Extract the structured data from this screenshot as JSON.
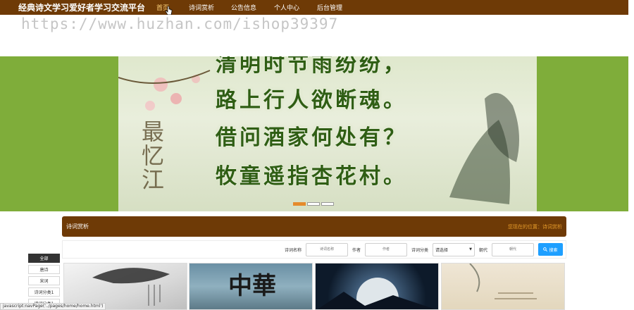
{
  "header": {
    "brand": "经典诗文学习爱好者学习交流平台",
    "nav": [
      "首页",
      "诗词赏析",
      "公告信息",
      "个人中心",
      "后台管理"
    ],
    "active_index": 0
  },
  "watermark": "https://www.huzhan.com/ishop39397",
  "banner": {
    "poem_lines": [
      "清明时节雨纷纷，",
      "路上行人欲断魂。",
      "借问酒家何处有？",
      "牧童遥指杏花村。"
    ],
    "side_text": "最忆江",
    "slide_count": 3,
    "active_slide": 0
  },
  "section": {
    "title": "诗词赏析",
    "breadcrumb_prefix": "您现在的位置：",
    "breadcrumb_current": "诗词赏析"
  },
  "search": {
    "name_label": "诗词名称",
    "name_placeholder": "诗词名称",
    "author_label": "作者",
    "author_placeholder": "作者",
    "category_label": "诗词分类",
    "category_value": "请选择",
    "dynasty_label": "朝代",
    "dynasty_placeholder": "朝代",
    "button_label": "搜索"
  },
  "categories": [
    "全部",
    "唐诗",
    "宋词",
    "诗词分类1",
    "诗词分类1"
  ],
  "cards": [
    {
      "text": ""
    },
    {
      "text": "中華"
    },
    {
      "text": ""
    },
    {
      "text": ""
    }
  ],
  "status_bar": "javascript:navPage('../pages/home/home.html')",
  "colors": {
    "header": "#6e3a06",
    "accent": "#e59b2a",
    "banner_bg": "#7fad3a",
    "button": "#1e9fff"
  }
}
